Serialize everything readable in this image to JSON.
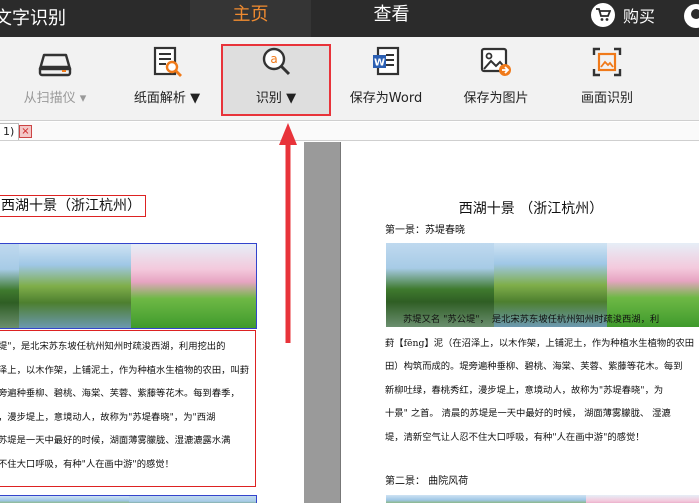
{
  "app": {
    "title": "文字识别"
  },
  "tabs": {
    "home": "主页",
    "view": "查看"
  },
  "buy": {
    "label": "购买"
  },
  "toolbar": {
    "scanner_label": "从扫描仪",
    "page_analysis_label": "纸面解析",
    "recognize_label": "识别",
    "save_word_label": "保存为Word",
    "save_image_label": "保存为图片",
    "screen_recognize_label": "画面识别"
  },
  "document_tab": {
    "label": "1)",
    "close_glyph": "×"
  },
  "left_doc": {
    "title": "西湖十景（浙江杭州）",
    "lines": [
      "堤\"，是北宋苏东坡任杭州知州时疏浚西湖，利用挖出的",
      "泽上，以木作架，上铺泥土，作为种植水生植物的农田，叫葑",
      "旁遍种垂柳、碧桃、海棠、芙蓉、紫藤等花木。每到春季，",
      "，漫步堤上，意境动人，故称为\"苏堤春晓\"，为\"西湖",
      "苏堤是一天中最好的时候，湖面薄雾朦胧、湿漉漉露水满",
      "不住大口呼吸，有种\"人在画中游\"的感觉！"
    ]
  },
  "right_doc": {
    "title": "西湖十景 （浙江杭州）",
    "section1": "第一景：苏堤春晓",
    "lines": [
      "苏堤又名 \"苏公堤\"， 是北宋苏东坡任杭州知州时疏浚西湖，利",
      "葑【fēng】泥（在沼泽上，以木作架，上铺泥土，作为种植水生植物的农田",
      "田）构筑而成的。堤旁遍种垂柳、碧桃、海棠、芙蓉、紫藤等花木。每到",
      "新柳吐绿，春桃秀红，漫步堤上，意境动人，故称为\"苏堤春晓\"，为",
      "十景\" 之首。 清晨的苏堤是一天中最好的时候， 湖面薄雾朦胧、 湿漉",
      "堤，清新空气让人忍不住大口呼吸，有种\"人在画中游\"的感觉！"
    ],
    "section2": "第二景：  曲院风荷"
  },
  "colors": {
    "topbar": "#2b2b2b",
    "active_tab_text": "#f08b30",
    "highlight_red": "#e8333a",
    "word_blue": "#2b5fb3",
    "accent_orange": "#f07a1a"
  },
  "icons": {
    "cart": "cart-icon",
    "user": "user-icon",
    "scanner": "scanner-icon",
    "page_analysis": "page-analysis-icon",
    "recognize": "recognize-magnifier-icon",
    "word": "word-doc-icon",
    "image": "image-export-icon",
    "screen": "screen-capture-icon"
  }
}
